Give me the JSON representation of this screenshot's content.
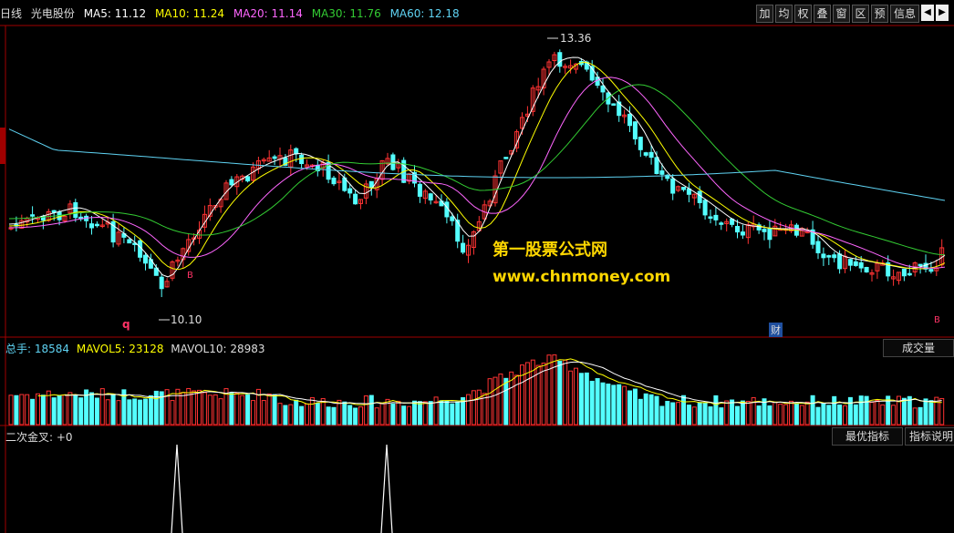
{
  "header": {
    "period": "日线",
    "stock_name": "光电股份",
    "ma5": "MA5: 11.12",
    "ma10": "MA10: 11.24",
    "ma20": "MA20: 11.14",
    "ma30": "MA30: 11.76",
    "ma60": "MA60: 12.18",
    "colors": {
      "ma5": "#ffffff",
      "ma10": "#ffff00",
      "ma20": "#ff66ff",
      "ma30": "#33cc33",
      "ma60": "#5fd3f3"
    }
  },
  "toolbar": {
    "buttons": [
      "加",
      "均",
      "权",
      "叠",
      "窗",
      "区",
      "预",
      "信息"
    ]
  },
  "price_panel": {
    "high_label": "13.36",
    "low_label": "10.10",
    "markers": {
      "q": "q",
      "b1": "B",
      "b2": "B",
      "cai": "财"
    }
  },
  "watermark": {
    "line1": "第一股票公式网",
    "line2": "www.chnmoney.com"
  },
  "volume_panel": {
    "total": "总手: 18584",
    "mavol5": "MAVOL5: 23128",
    "mavol10": "MAVOL10: 28983",
    "tab": "成交量"
  },
  "indicator_panel": {
    "name": "二次金叉: +0",
    "tab_best": "最优指标",
    "tab_help": "指标说明"
  },
  "colors": {
    "up": "#ff3333",
    "down": "#54ffff",
    "axis": "#a00000"
  }
}
